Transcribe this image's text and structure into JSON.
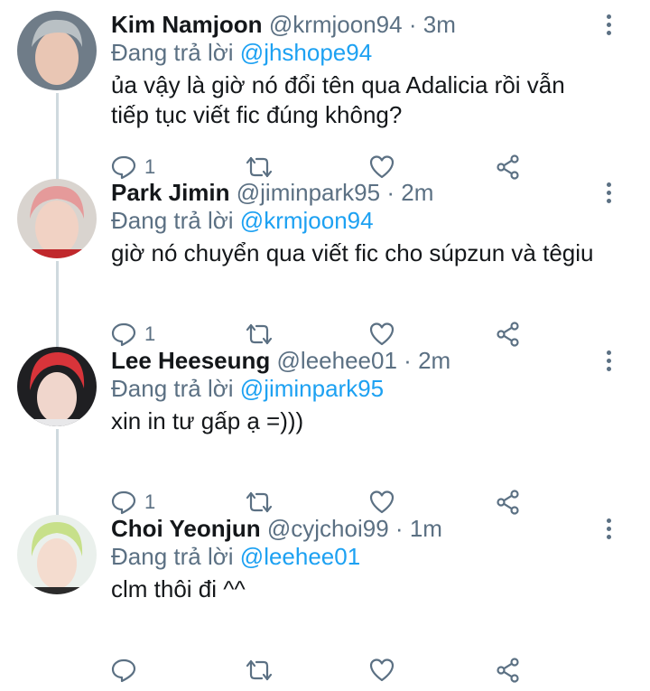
{
  "reply_prefix": "Đang trả lời",
  "tweets": [
    {
      "name": "Kim Namjoon",
      "handle": "@krmjoon94",
      "time": "3m",
      "reply_to": "@jhshope94",
      "text": "ủa vậy là giờ nó đổi tên qua Adalicia rồi vẫn tiếp tục viết fic đúng không?",
      "reply_count": "1",
      "avatar_colors": {
        "bg": "#6f7c88",
        "hair": "#b9c0c4",
        "skin": "#e9c6b4"
      }
    },
    {
      "name": "Park Jimin",
      "handle": "@jiminpark95",
      "time": "2m",
      "reply_to": "@krmjoon94",
      "text": "giờ nó chuyển qua viết fic cho súpzun và têgiu",
      "reply_count": "1",
      "avatar_colors": {
        "bg": "#d9d4cf",
        "hair": "#e59a9a",
        "skin": "#f1d2c4"
      }
    },
    {
      "name": "Lee Heeseung",
      "handle": "@leehee01",
      "time": "2m",
      "reply_to": "@jiminpark95",
      "text": "xin in tư gấp ạ =)))",
      "reply_count": "1",
      "avatar_colors": {
        "bg": "#1f1f22",
        "hair": "#d8343a",
        "skin": "#f0d6cc"
      }
    },
    {
      "name": "Choi Yeonjun",
      "handle": "@cyjchoi99",
      "time": "1m",
      "reply_to": "@leehee01",
      "text": "clm thôi đi ^^",
      "reply_count": "",
      "avatar_colors": {
        "bg": "#eaf0ec",
        "hair": "#c7e08a",
        "skin": "#f4dccf"
      }
    }
  ],
  "icons": {
    "reply": "reply-icon",
    "retweet": "retweet-icon",
    "like": "heart-icon",
    "share": "share-icon",
    "more": "more-icon"
  },
  "colors": {
    "name": "#14171a",
    "secondary": "#5b7083",
    "link": "#1da1f2",
    "thread_line": "#cfd9de"
  }
}
